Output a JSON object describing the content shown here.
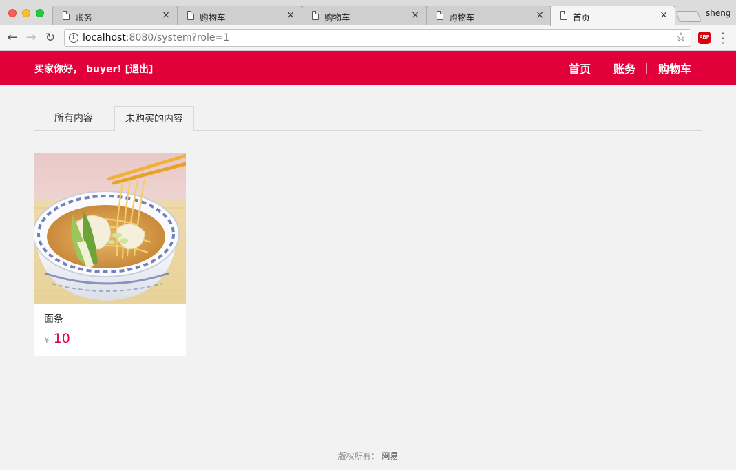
{
  "browser": {
    "tabs": [
      {
        "title": "账务"
      },
      {
        "title": "购物车"
      },
      {
        "title": "购物车"
      },
      {
        "title": "购物车"
      },
      {
        "title": "首页"
      }
    ],
    "close_glyph": "×",
    "profile": "sheng",
    "url_host": "localhost",
    "url_rest": ":8080/system?role=1",
    "abp": "ABP"
  },
  "header": {
    "greeting": "买家你好， buyer!",
    "logout": "[退出]",
    "nav": [
      {
        "label": "首页"
      },
      {
        "label": "账务"
      },
      {
        "label": "购物车"
      }
    ],
    "color": "#e2003b"
  },
  "content_tabs": [
    {
      "label": "所有内容"
    },
    {
      "label": "未购买的内容",
      "active": true
    }
  ],
  "products": [
    {
      "title": "面条",
      "currency": "¥",
      "price": "10"
    }
  ],
  "footer": {
    "prefix": "版权所有：",
    "brand": "网易"
  }
}
